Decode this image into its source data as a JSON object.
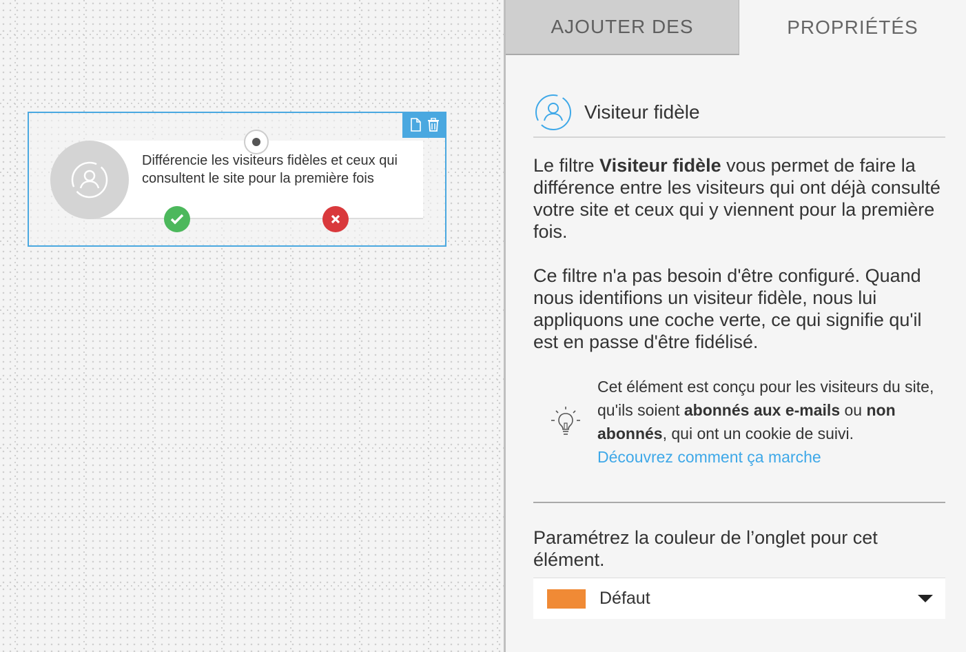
{
  "canvas": {
    "node": {
      "text": "Différencie les visiteurs fidèles et ceux qui consultent le site pour la première fois",
      "icon": "returning-visitor-icon",
      "toolbar": {
        "duplicate_icon": "document-icon",
        "delete_icon": "trash-icon"
      },
      "yes_color": "#4cb85c",
      "no_color": "#d9393c"
    }
  },
  "panel": {
    "tabs": [
      {
        "label": "AJOUTER DES"
      },
      {
        "label": "PROPRIÉTÉS"
      }
    ],
    "header": {
      "icon": "returning-visitor-icon",
      "title": "Visiteur fidèle"
    },
    "description": {
      "prefix": "Le filtre ",
      "bold": "Visiteur fidèle",
      "suffix": " vous permet de faire la différence entre les visiteurs qui ont déjà consulté votre site et ceux qui y viennent pour la première fois."
    },
    "description2": "Ce filtre n'a pas besoin d'être configuré. Quand nous identifions un visiteur fidèle, nous lui appliquons une coche verte, ce qui signifie qu'il est en passe d'être fidélisé.",
    "tip": {
      "icon": "lightbulb-icon",
      "part1": "Cet élément est conçu pour les visiteurs du site, qu'ils soient ",
      "bold1": "abonnés aux e-mails",
      "part2": " ou ",
      "bold2": "non abonnés",
      "part3": ", qui ont un cookie de suivi.",
      "link": "Découvrez comment ça marche"
    },
    "color_setting": {
      "label": "Paramétrez la couleur de l’onglet pour cet élément.",
      "selected": "Défaut",
      "swatch_color": "#f08a35"
    }
  },
  "colors": {
    "accent": "#4aa8e0",
    "link": "#3ea8e8"
  }
}
